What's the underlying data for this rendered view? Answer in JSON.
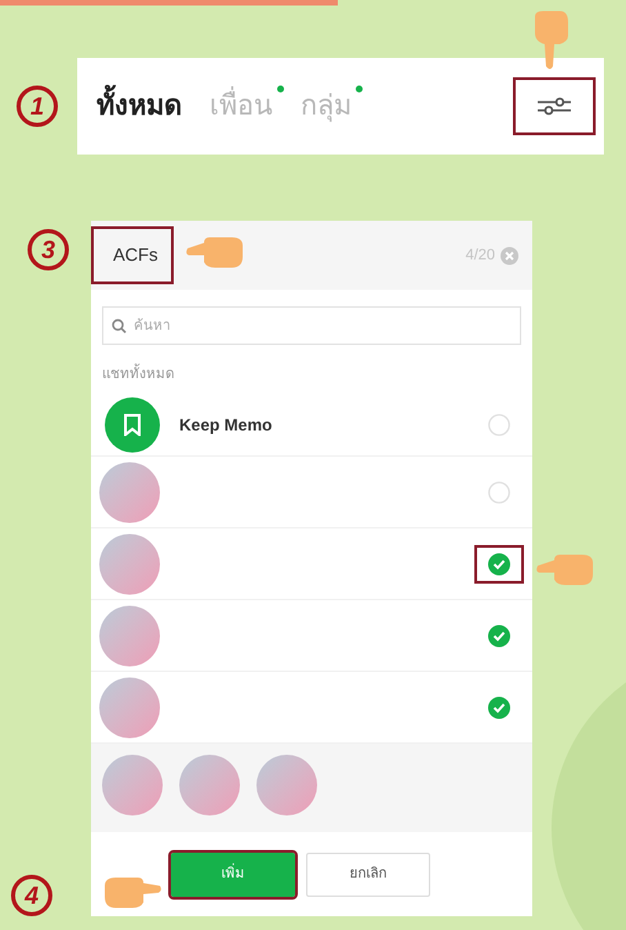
{
  "step_1": {
    "number": "1"
  },
  "tabs": [
    {
      "label": "ทั้งหมด",
      "selected": true,
      "dot": false
    },
    {
      "label": "เพื่อน",
      "selected": false,
      "dot": true
    },
    {
      "label": "กลุ่ม",
      "selected": false,
      "dot": true
    }
  ],
  "filter_button": {
    "highlighted": true
  },
  "step_3": {
    "number": "3"
  },
  "dialog": {
    "title": "ACFs",
    "title_highlighted": true,
    "counter": "4/20",
    "search": {
      "placeholder": "ค้นหา"
    },
    "section": "แชททั้งหมด",
    "chats": [
      {
        "kind": "memo",
        "name": "Keep Memo",
        "checked": false,
        "highlighted": false
      },
      {
        "kind": "contact",
        "checked": false,
        "highlighted": false
      },
      {
        "kind": "contact",
        "checked": true,
        "highlighted": true
      },
      {
        "kind": "contact",
        "checked": true,
        "highlighted": false
      },
      {
        "kind": "contact",
        "checked": true,
        "highlighted": false
      }
    ],
    "selected_avatars": [
      {
        "kind": "contact"
      },
      {
        "kind": "contact"
      },
      {
        "kind": "contact"
      }
    ],
    "buttons": [
      {
        "label": "เพิ่ม",
        "kind": "primary",
        "highlighted": true
      },
      {
        "label": "ยกเลิก",
        "kind": "secondary",
        "highlighted": false
      }
    ]
  },
  "step_4": {
    "number": "4"
  }
}
